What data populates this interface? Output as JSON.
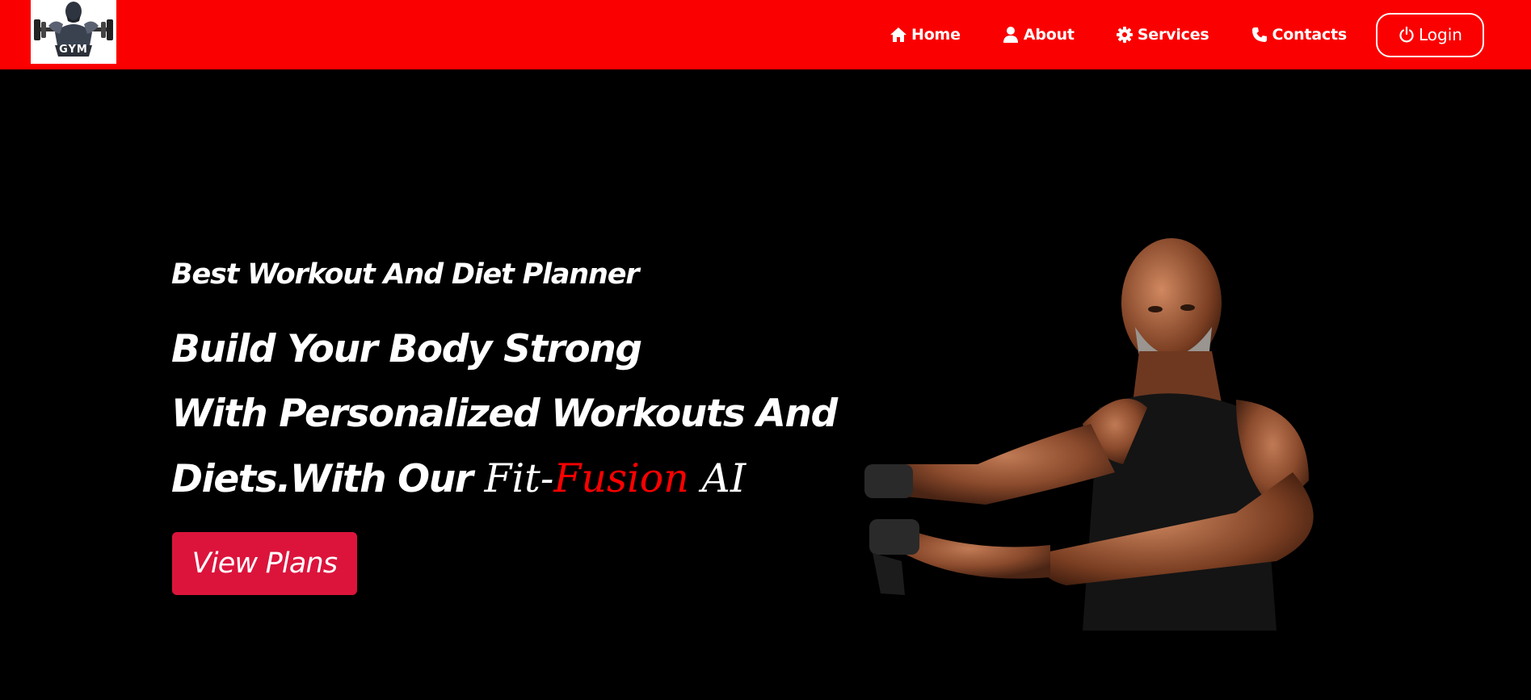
{
  "header": {
    "logo_text": "GYM",
    "nav": [
      {
        "label": "Home",
        "icon": "home-icon"
      },
      {
        "label": "About",
        "icon": "user-icon"
      },
      {
        "label": "Services",
        "icon": "gear-icon"
      },
      {
        "label": "Contacts",
        "icon": "phone-icon"
      }
    ],
    "login_label": "Login",
    "login_icon": "power-icon"
  },
  "hero": {
    "subtitle": "Best Workout And Diet Planner",
    "line1": "Build Your Body Strong",
    "line2": "With Personalized Workouts And",
    "line3_prefix": "Diets.With Our ",
    "brand_fit": "Fit-",
    "brand_fusion": "Fusion",
    "brand_ai": " AI",
    "cta_label": "View Plans"
  },
  "colors": {
    "nav_bg": "#fb0000",
    "page_bg": "#000000",
    "cta_bg": "#dc143c",
    "brand_accent": "#ff0000",
    "text": "#ffffff"
  }
}
